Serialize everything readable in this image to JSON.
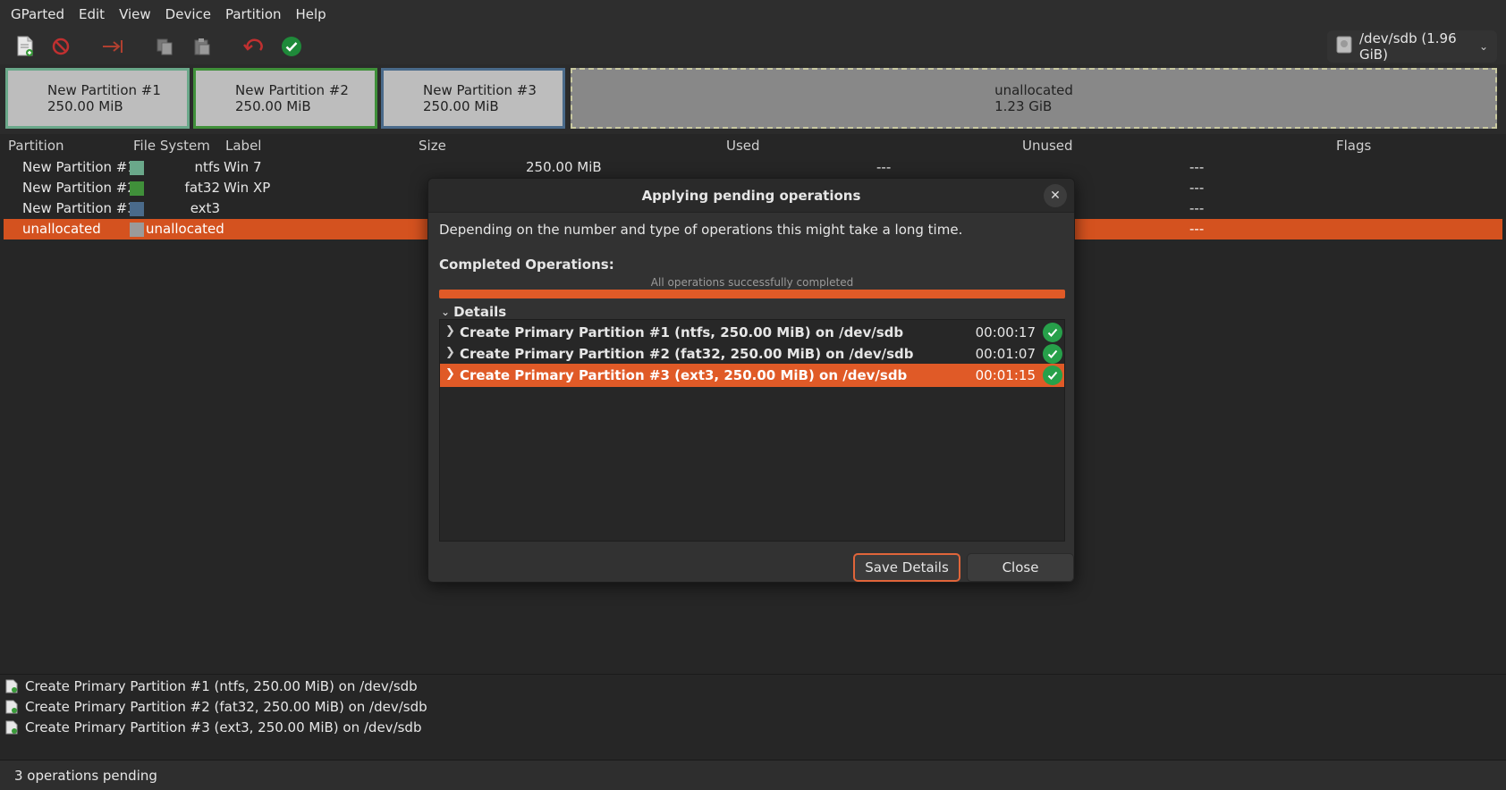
{
  "menu": [
    "GParted",
    "Edit",
    "View",
    "Device",
    "Partition",
    "Help"
  ],
  "toolbar": {
    "icons": [
      "new-icon",
      "delete-icon",
      "resize-icon",
      "copy-icon",
      "paste-icon",
      "undo-icon",
      "apply-icon"
    ],
    "device_label": "/dev/sdb (1.96 GiB)"
  },
  "diskmap": [
    {
      "name": "New Partition #1",
      "size": "250.00 MiB"
    },
    {
      "name": "New Partition #2",
      "size": "250.00 MiB"
    },
    {
      "name": "New Partition #3",
      "size": "250.00 MiB"
    },
    {
      "name": "unallocated",
      "size": "1.23 GiB"
    }
  ],
  "table": {
    "headers": [
      "Partition",
      "File System",
      "Label",
      "Size",
      "Used",
      "Unused",
      "Flags"
    ],
    "rows": [
      {
        "partition": "New Partition #1",
        "fs": "ntfs",
        "label": "Win 7",
        "size": "250.00 MiB",
        "used": "---",
        "unused": "---",
        "color": "#6aa88a"
      },
      {
        "partition": "New Partition #2",
        "fs": "fat32",
        "label": "Win XP",
        "size": "",
        "used": "",
        "unused": "---",
        "color": "#40903a"
      },
      {
        "partition": "New Partition #3",
        "fs": "ext3",
        "label": "",
        "size": "",
        "used": "",
        "unused": "---",
        "color": "#4a6a8a"
      },
      {
        "partition": "unallocated",
        "fs": "unallocated",
        "label": "",
        "size": "",
        "used": "",
        "unused": "---",
        "color": "#9a9a9a"
      }
    ]
  },
  "pending_ops": [
    "Create Primary Partition #1 (ntfs, 250.00 MiB) on /dev/sdb",
    "Create Primary Partition #2 (fat32, 250.00 MiB) on /dev/sdb",
    "Create Primary Partition #3 (ext3, 250.00 MiB) on /dev/sdb"
  ],
  "status": "3 operations pending",
  "dialog": {
    "title": "Applying pending operations",
    "message": "Depending on the number and type of operations this might take a long time.",
    "completed_label": "Completed Operations:",
    "progress_text": "All operations successfully completed",
    "progress": 1.0,
    "details_label": "Details",
    "operations": [
      {
        "text": "Create Primary Partition #1 (ntfs, 250.00 MiB) on /dev/sdb",
        "time": "00:00:17"
      },
      {
        "text": "Create Primary Partition #2 (fat32, 250.00 MiB) on /dev/sdb",
        "time": "00:01:07"
      },
      {
        "text": "Create Primary Partition #3 (ext3, 250.00 MiB) on /dev/sdb",
        "time": "00:01:15"
      }
    ],
    "save_label": "Save Details",
    "close_label": "Close"
  },
  "colors": {
    "accent": "#e05a27",
    "selection": "#d4521f",
    "success": "#27a04a"
  }
}
